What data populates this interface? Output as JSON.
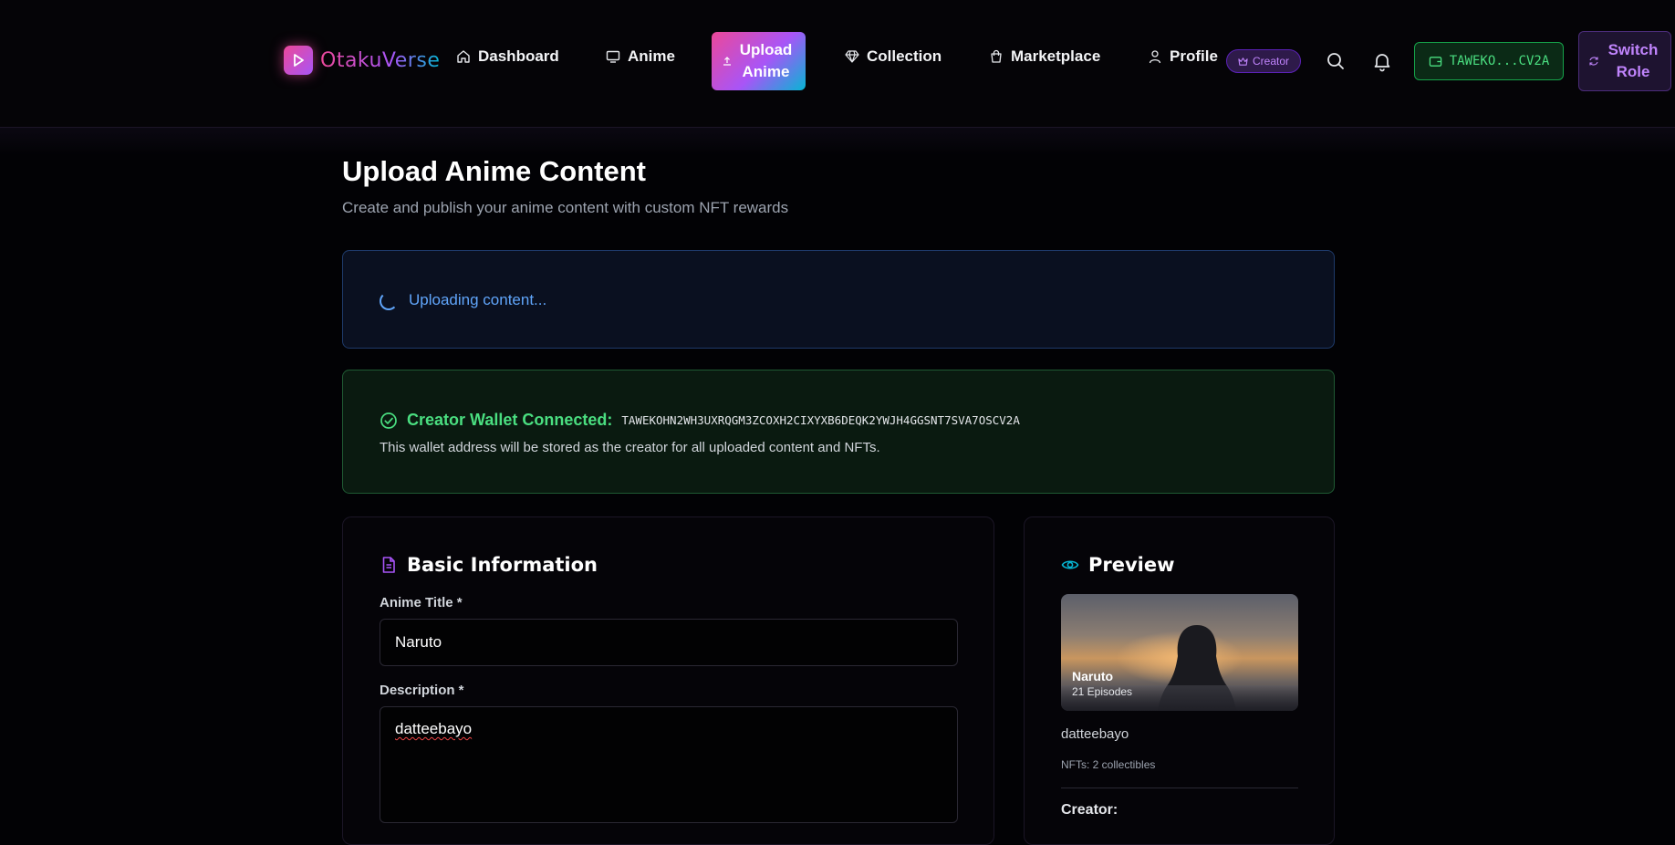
{
  "header": {
    "brand": "OtakuVerse",
    "nav": {
      "dashboard": "Dashboard",
      "anime": "Anime",
      "upload": "Upload Anime",
      "collection": "Collection",
      "marketplace": "Marketplace",
      "profile": "Profile"
    },
    "role_badge": "Creator",
    "wallet_short": "TAWEKO...CV2A",
    "switch_role": "Switch Role",
    "icons": [
      "home-icon",
      "tv-icon",
      "upload-icon",
      "gem-icon",
      "bag-icon",
      "user-icon",
      "crown-icon",
      "search-icon",
      "bell-icon",
      "wallet-icon",
      "refresh-icon"
    ]
  },
  "page": {
    "title": "Upload Anime Content",
    "subtitle": "Create and publish your anime content with custom NFT rewards"
  },
  "status": {
    "text": "Uploading content..."
  },
  "wallet_box": {
    "label": "Creator Wallet Connected:",
    "address": "TAWEKOHN2WH3UXRQGM3ZCOXH2CIXYXB6DEQK2YWJH4GGSNT7SVA7OSCV2A",
    "note": "This wallet address will be stored as the creator for all uploaded content and NFTs."
  },
  "basic_info": {
    "heading": "Basic Information",
    "title_label": "Anime Title *",
    "title_value": "Naruto",
    "desc_label": "Description *",
    "desc_value": "datteebayo"
  },
  "preview": {
    "heading": "Preview",
    "title": "Naruto",
    "episodes": "21 Episodes",
    "description": "datteebayo",
    "nfts": "NFTs: 2 collectibles",
    "creator_label": "Creator:"
  },
  "colors": {
    "accent_pink": "#ec4899",
    "accent_purple": "#a855f7",
    "accent_cyan": "#06b6d4",
    "success": "#4ade80",
    "info": "#60a5fa"
  }
}
